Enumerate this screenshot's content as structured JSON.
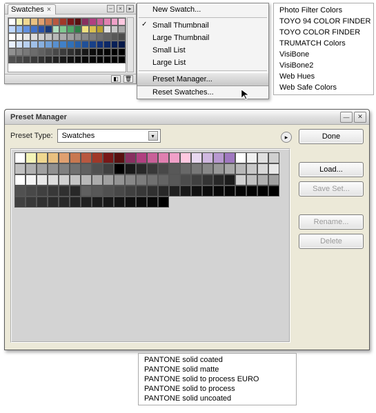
{
  "swatches": {
    "tab_label": "Swatches",
    "rows": [
      [
        "#ffffff",
        "#f4f4b8",
        "#f0d890",
        "#e8c080",
        "#e0a070",
        "#c87850",
        "#b85840",
        "#a03828",
        "#781818",
        "#581010",
        "#883060",
        "#b04080",
        "#c86098",
        "#e080b0",
        "#f0a0c8",
        "#ffc8e0"
      ],
      [
        "#c0d8ff",
        "#90b8f0",
        "#6090e0",
        "#4070c8",
        "#2850a8",
        "#183878",
        "#b0e0c0",
        "#80c890",
        "#50a868",
        "#308048",
        "#f0e080",
        "#d8c050",
        "#b8a030",
        "#e0e0e0",
        "#c8c8c8",
        "#a8a8a8"
      ],
      [
        "#ffffff",
        "#f4f4f4",
        "#e8e8e8",
        "#dcdcdc",
        "#d0d0d0",
        "#c4c4c4",
        "#b8b8b8",
        "#acacac",
        "#a0a0a0",
        "#949494",
        "#888888",
        "#7c7c7c",
        "#707070",
        "#646464",
        "#585858",
        "#4c4c4c"
      ],
      [
        "#e8f0ff",
        "#d0e0f8",
        "#b8d0f0",
        "#a0c0e8",
        "#88b0e0",
        "#70a0d8",
        "#5890d0",
        "#4080c8",
        "#3070b8",
        "#2860a8",
        "#205098",
        "#184088",
        "#103078",
        "#0c2868",
        "#082058",
        "#041848"
      ],
      [
        "#909090",
        "#848484",
        "#787878",
        "#6c6c6c",
        "#606060",
        "#545454",
        "#484848",
        "#3c3c3c",
        "#303030",
        "#242424",
        "#181818",
        "#0c0c0c",
        "#080808",
        "#040404",
        "#020202",
        "#000000"
      ],
      [
        "#505050",
        "#484848",
        "#404040",
        "#383838",
        "#303030",
        "#282828",
        "#202020",
        "#181818",
        "#101010",
        "#0c0c0c",
        "#080808",
        "#060606",
        "#040404",
        "#030303",
        "#020202",
        "#000000"
      ]
    ]
  },
  "flyout": {
    "new_swatch": "New Swatch...",
    "small_thumb": "Small Thumbnail",
    "large_thumb": "Large Thumbnail",
    "small_list": "Small List",
    "large_list": "Large List",
    "preset_manager": "Preset Manager...",
    "reset": "Reset Swatches..."
  },
  "right_list": [
    "Photo Filter Colors",
    "TOYO 94 COLOR FINDER",
    "TOYO COLOR FINDER",
    "TRUMATCH Colors",
    "VisiBone",
    "VisiBone2",
    "Web Hues",
    "Web Safe Colors"
  ],
  "dialog": {
    "title": "Preset Manager",
    "type_label": "Preset Type:",
    "type_value": "Swatches",
    "buttons": {
      "done": "Done",
      "load": "Load...",
      "save": "Save Set...",
      "rename": "Rename...",
      "delete": "Delete"
    },
    "rows": [
      [
        "#ffffff",
        "#f4f4b8",
        "#f0d890",
        "#e8c080",
        "#e0a070",
        "#c87850",
        "#b85840",
        "#a03828",
        "#781818",
        "#581010",
        "#883060",
        "#b04080",
        "#c86098",
        "#e080b0",
        "#f0a0c8",
        "#ffc8e0",
        "#e8d8f0",
        "#d0b8e0",
        "#b898d0",
        "#a078c0",
        "#ffffff",
        "#f0f0f0",
        "#e0e0e0",
        "#d0d0d0"
      ],
      [
        "#c0c0c0",
        "#b0b0b0",
        "#a0a0a0",
        "#909090",
        "#808080",
        "#707070",
        "#606060",
        "#505050",
        "#404040",
        "#000000",
        "#181818",
        "#282828",
        "#383838",
        "#484848",
        "#585858",
        "#686868",
        "#787878",
        "#888888",
        "#989898",
        "#a8a8a8",
        "#b8b8b8",
        "#c8c8c8",
        "#d8d8d8",
        "#e8e8e8"
      ],
      [
        "#ffffff",
        "#f4f4f4",
        "#e8e8e8",
        "#dcdcdc",
        "#d0d0d0",
        "#c4c4c4",
        "#b8b8b8",
        "#acacac",
        "#a0a0a0",
        "#949494",
        "#888888",
        "#7c7c7c",
        "#707070",
        "#646464",
        "#585858",
        "#4c4c4c",
        "#404040",
        "#343434",
        "#282828",
        "#1c1c1c",
        "#d0d0d0",
        "#c0c0c0",
        "#b0b0b0",
        "#a0a0a0"
      ],
      [
        "#505050",
        "#484848",
        "#404040",
        "#383838",
        "#303030",
        "#282828",
        "#606060",
        "#585858",
        "#505050",
        "#484848",
        "#404040",
        "#383838",
        "#303030",
        "#282828",
        "#202020",
        "#181818",
        "#101010",
        "#0c0c0c",
        "#080808",
        "#060606",
        "#040404",
        "#030303",
        "#020202",
        "#000000"
      ],
      [
        "#404040",
        "#383838",
        "#303030",
        "#2c2c2c",
        "#282828",
        "#242424",
        "#202020",
        "#1c1c1c",
        "#181818",
        "#141414",
        "#101010",
        "#0c0c0c",
        "#080808",
        "#000000"
      ]
    ]
  },
  "bottom_list": [
    "PANTONE solid coated",
    "PANTONE solid matte",
    "PANTONE solid to process EURO",
    "PANTONE solid to process",
    "PANTONE solid uncoated"
  ]
}
